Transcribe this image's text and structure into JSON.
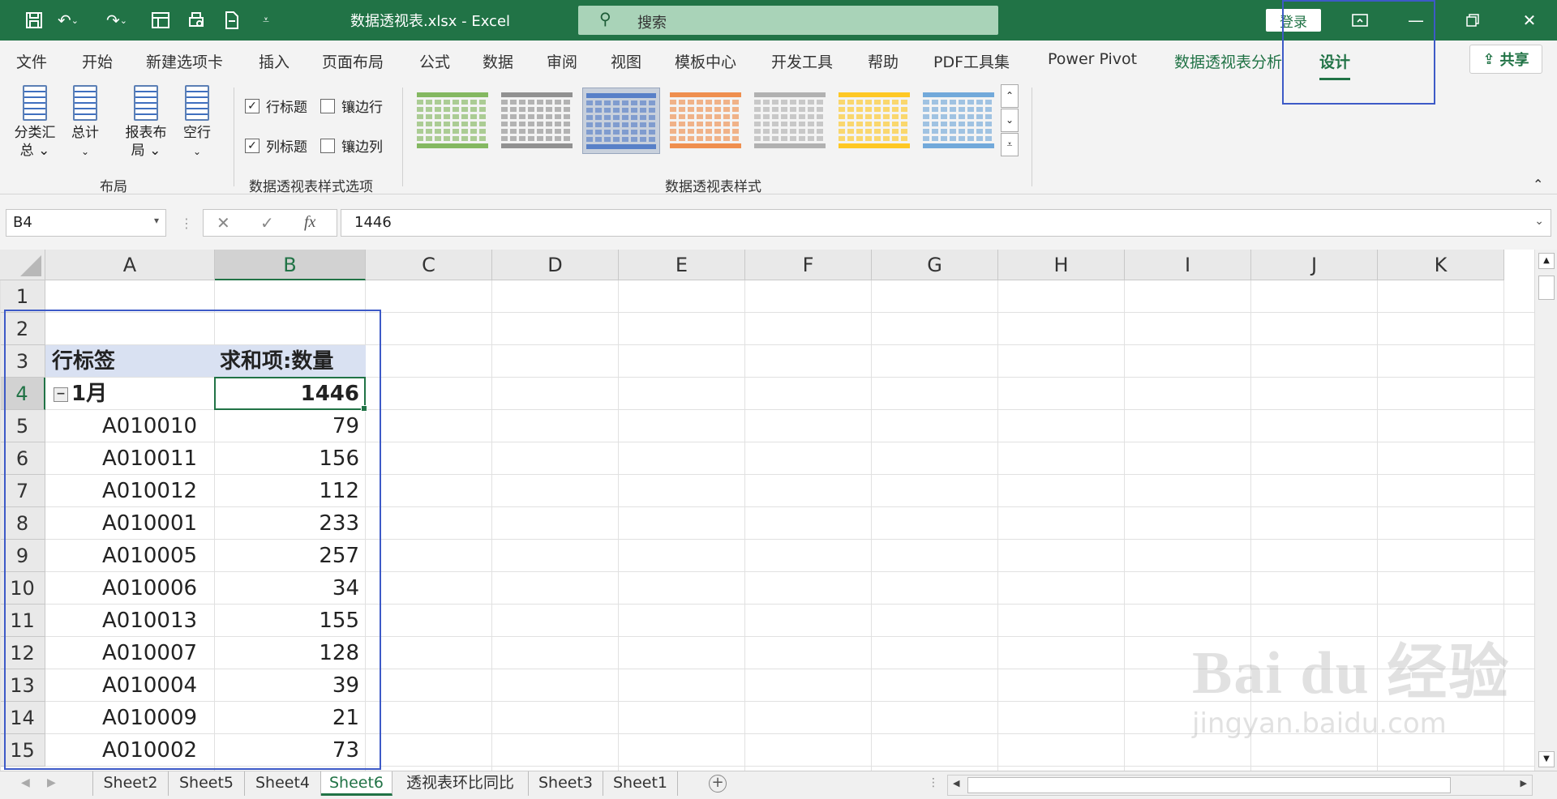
{
  "window": {
    "title": "数据透视表.xlsx  -  Excel",
    "search_label": "搜索",
    "login": "登录"
  },
  "tabs": [
    "文件",
    "开始",
    "新建选项卡",
    "插入",
    "页面布局",
    "公式",
    "数据",
    "审阅",
    "视图",
    "模板中心",
    "开发工具",
    "帮助",
    "PDF工具集",
    "Power Pivot",
    "数据透视表分析",
    "设计"
  ],
  "active_tab": "设计",
  "share": "共享",
  "ribbon": {
    "layout_group": {
      "buttons": [
        "分类汇\n总",
        "总计",
        "报表布\n局",
        "空行"
      ],
      "label": "布局"
    },
    "options_group": {
      "row_headers": "行标题",
      "col_headers": "列标题",
      "banded_rows": "镶边行",
      "banded_cols": "镶边列",
      "label": "数据透视表样式选项"
    },
    "styles_group": {
      "label": "数据透视表样式",
      "tile_colors": [
        "#70ad47",
        "#7f7f7f",
        "#4472c4",
        "#ed7d31",
        "#a5a5a5",
        "#ffc000",
        "#5b9bd5"
      ]
    }
  },
  "formula_bar": {
    "name_box": "B4",
    "cancel": "✕",
    "enter": "✓",
    "fx": "fx",
    "value": "1446"
  },
  "columns": [
    "A",
    "B",
    "C",
    "D",
    "E",
    "F",
    "G",
    "H",
    "I",
    "J",
    "K"
  ],
  "rows": [
    "1",
    "2",
    "3",
    "4",
    "5",
    "6",
    "7",
    "8",
    "9",
    "10",
    "11",
    "12",
    "13",
    "14",
    "15"
  ],
  "pivot": {
    "header_label": "行标签",
    "header_value": "求和项:数量",
    "group_label": "1月",
    "group_total": "1446",
    "items": [
      {
        "code": "A010010",
        "qty": "79"
      },
      {
        "code": "A010011",
        "qty": "156"
      },
      {
        "code": "A010012",
        "qty": "112"
      },
      {
        "code": "A010001",
        "qty": "233"
      },
      {
        "code": "A010005",
        "qty": "257"
      },
      {
        "code": "A010006",
        "qty": "34"
      },
      {
        "code": "A010013",
        "qty": "155"
      },
      {
        "code": "A010007",
        "qty": "128"
      },
      {
        "code": "A010004",
        "qty": "39"
      },
      {
        "code": "A010009",
        "qty": "21"
      },
      {
        "code": "A010002",
        "qty": "73"
      }
    ]
  },
  "sheet_tabs": [
    "Sheet2",
    "Sheet5",
    "Sheet4",
    "Sheet6",
    "透视表环比同比",
    "Sheet3",
    "Sheet1"
  ],
  "active_sheet": "Sheet6",
  "watermark": {
    "main": "Bai du 经验",
    "sub": "jingyan.baidu.com"
  }
}
